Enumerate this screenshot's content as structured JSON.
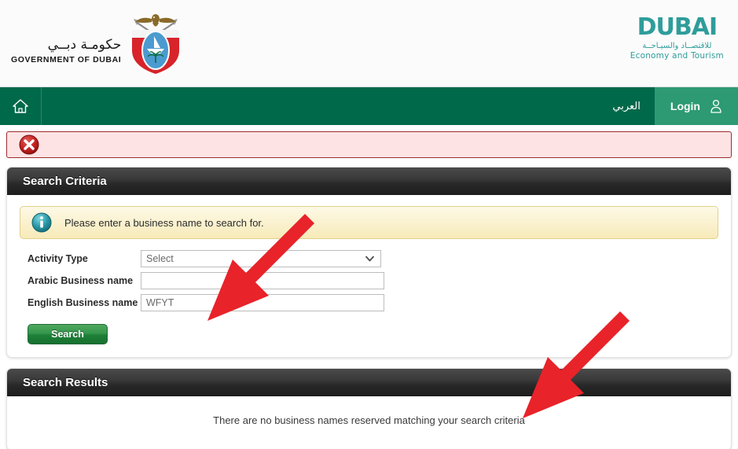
{
  "header": {
    "gov_logo": {
      "arabic": "حكومـة دبــي",
      "english": "GOVERNMENT OF DUBAI",
      "emblem_name": "dubai-government-emblem"
    },
    "det_logo": {
      "wordmark": "DUBAI",
      "arabic": "للاقتصــاد والسيـاحــة",
      "english": "Economy and Tourism"
    }
  },
  "navbar": {
    "home_icon": "home-icon",
    "arabic_label": "العربي",
    "login_label": "Login",
    "login_icon": "user-icon",
    "colors": {
      "nav_background": "#00694a",
      "login_background": "#2d9a74"
    }
  },
  "error_banner": {
    "icon": "error-circle-x-icon",
    "message": "",
    "colors": {
      "background": "#fde3e4",
      "border": "#9c2c2c",
      "icon": "#b01d1d"
    }
  },
  "search_criteria": {
    "panel_title": "Search Criteria",
    "info": {
      "icon": "info-circle-icon",
      "message": "Please enter a business name to search for."
    },
    "fields": [
      {
        "label": "Activity Type",
        "type": "select",
        "value": "Select",
        "options": [
          "Select"
        ],
        "name": "activity-type"
      },
      {
        "label": "Arabic Business name",
        "type": "text",
        "value": "",
        "placeholder": "",
        "name": "arabic-business-name"
      },
      {
        "label": "English Business name",
        "type": "text",
        "value": "WFYT",
        "placeholder": "",
        "name": "english-business-name"
      }
    ],
    "search_button": "Search"
  },
  "search_results": {
    "panel_title": "Search Results",
    "empty_message": "There are no business names reserved matching your search criteria"
  },
  "annotations": {
    "arrow_color": "#e8232a",
    "arrows": [
      {
        "name": "arrow-to-english-business-name",
        "target": "english-business-name-input"
      },
      {
        "name": "arrow-to-empty-results-message",
        "target": "search-results-empty-message"
      }
    ]
  }
}
